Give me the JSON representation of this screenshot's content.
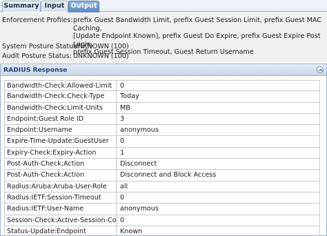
{
  "tabs": [
    {
      "label": "Summary",
      "active": false
    },
    {
      "label": "Input",
      "active": false
    },
    {
      "label": "Output",
      "active": true
    }
  ],
  "info": {
    "enforcement_profiles": {
      "label": "Enforcement Profiles:",
      "lines": [
        "prefix Guest Bandwidth Limit, prefix Guest Session Limit, prefix Guest MAC Caching,",
        "[Update Endpoint Known], prefix Guest Do Expire, prefix Guest Expire Post Login,",
        "prefix Guest Session Timeout, Guest Return Username"
      ]
    },
    "system_posture": {
      "label": "System Posture Status:",
      "value": "UNKNOWN (100)"
    },
    "audit_posture": {
      "label": "Audit Posture Status:",
      "value": "UNKNOWN (100)"
    }
  },
  "radius_response": {
    "title": "RADIUS Response",
    "collapse_icon": "chevron-up-circle-icon",
    "rows": [
      {
        "key": "Bandwidth-Check:Allowed-Limit",
        "value": "0"
      },
      {
        "key": "Bandwidth-Check:Check-Type",
        "value": "Today"
      },
      {
        "key": "Bandwidth-Check:Limit-Units",
        "value": "MB"
      },
      {
        "key": "Endpoint:Guest Role ID",
        "value": "3"
      },
      {
        "key": "Endpoint:Username",
        "value": "anonymous"
      },
      {
        "key": "Expire-Time-Update:GuestUser",
        "value": "0"
      },
      {
        "key": "Expiry-Check:Expiry-Action",
        "value": "1"
      },
      {
        "key": "Post-Auth-Check:Action",
        "value": "Disconnect"
      },
      {
        "key": "Post-Auth-Check:Action",
        "value": "Disconnect and Block Access"
      },
      {
        "key": "Radius:Aruba:Aruba-User-Role",
        "value": "all"
      },
      {
        "key": "Radius:IETF:Session-Timeout",
        "value": "0"
      },
      {
        "key": "Radius:IETF:User-Name",
        "value": "anonymous"
      },
      {
        "key": "Session-Check:Active-Session-Count",
        "value": "0"
      },
      {
        "key": "Status-Update:Endpoint",
        "value": "Known"
      }
    ]
  }
}
